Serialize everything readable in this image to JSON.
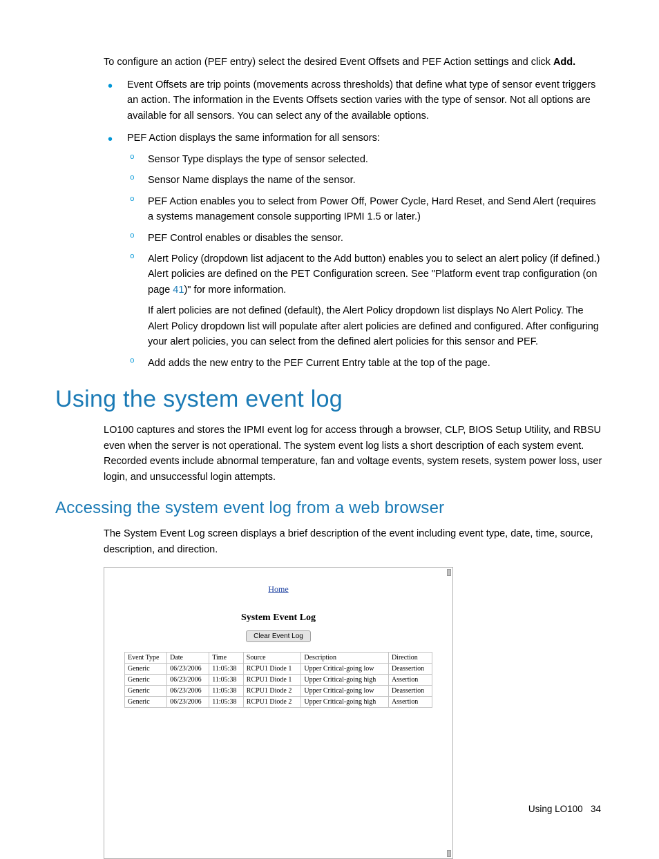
{
  "intro": {
    "line": "To configure an action (PEF entry) select the desired Event Offsets and PEF Action settings and click ",
    "bold": "Add."
  },
  "bullets1": {
    "event_offsets": "Event Offsets are trip points (movements across thresholds) that define what type of sensor event triggers an action. The information in the Events Offsets section varies with the type of sensor. Not all options are available for all sensors. You can select any of the available options.",
    "pef_action": "PEF Action displays the same information for all sensors:"
  },
  "sub": {
    "sensor_type": "Sensor Type displays the type of sensor selected.",
    "sensor_name": "Sensor Name displays the name of the sensor.",
    "pef_action": "PEF Action enables you to select from Power Off, Power Cycle, Hard Reset, and Send Alert (requires a systems management console supporting IPMI 1.5 or later.)",
    "pef_control": "PEF Control enables or disables the sensor.",
    "alert_policy_a": "Alert Policy (dropdown list adjacent to the Add button) enables you to select an alert policy (if defined.) Alert policies are defined on the PET Configuration screen. See \"Platform event trap configuration (on page ",
    "alert_policy_page": "41",
    "alert_policy_b": ")\" for more information.",
    "alert_policy_note": "If alert policies are not defined (default), the Alert Policy dropdown list displays No Alert Policy. The Alert Policy dropdown list will populate after alert policies are defined and configured. After configuring your alert policies, you can select from the defined alert policies for this sensor and PEF.",
    "add": "Add adds the new entry to the PEF Current Entry table at the top of the page."
  },
  "h1": "Using the system event log",
  "p1": "LO100 captures and stores the IPMI event log for access through a browser, CLP, BIOS Setup Utility, and RBSU even when the server is not operational. The system event log lists a short description of each system event. Recorded events include abnormal temperature, fan and voltage events, system resets, system power loss, user login, and unsuccessful login attempts.",
  "h2": "Accessing the system event log from a web browser",
  "p2": "The System Event Log screen displays a brief description of the event including event type, date, time, source, description, and direction.",
  "shot": {
    "home": "Home",
    "title": "System Event Log",
    "clear": "Clear Event Log",
    "headers": [
      "Event Type",
      "Date",
      "Time",
      "Source",
      "Description",
      "Direction"
    ],
    "rows": [
      [
        "Generic",
        "06/23/2006",
        "11:05:38",
        "RCPU1 Diode 1",
        "Upper Critical-going low",
        "Deassertion"
      ],
      [
        "Generic",
        "06/23/2006",
        "11:05:38",
        "RCPU1 Diode 1",
        "Upper Critical-going high",
        "Assertion"
      ],
      [
        "Generic",
        "06/23/2006",
        "11:05:38",
        "RCPU1 Diode 2",
        "Upper Critical-going low",
        "Deassertion"
      ],
      [
        "Generic",
        "06/23/2006",
        "11:05:38",
        "RCPU1 Diode 2",
        "Upper Critical-going high",
        "Assertion"
      ]
    ]
  },
  "footer": {
    "section": "Using LO100",
    "page": "34"
  }
}
